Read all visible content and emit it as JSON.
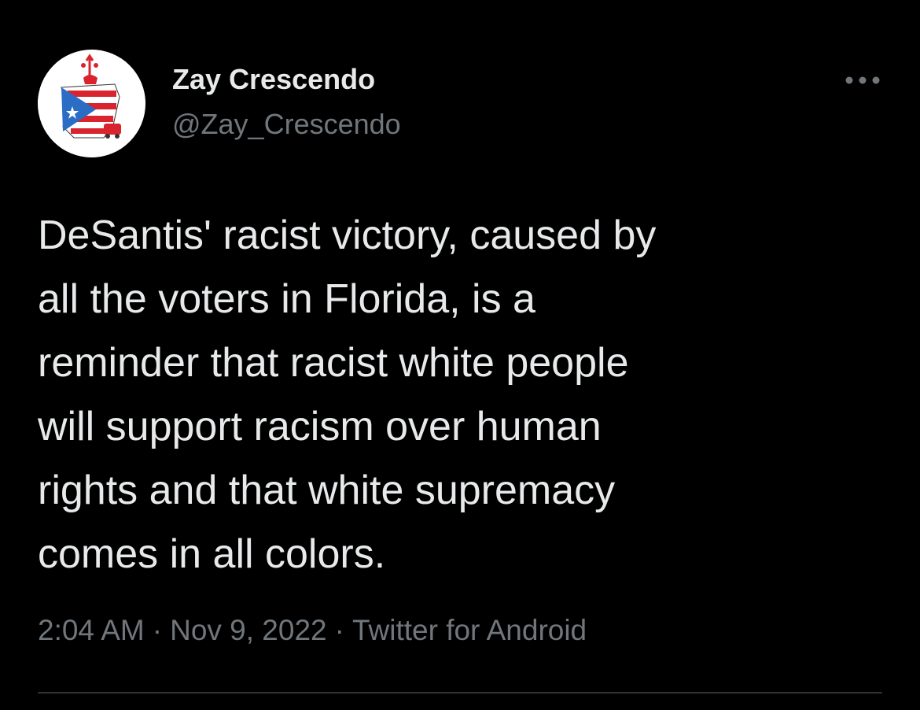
{
  "author": {
    "display_name": "Zay Crescendo",
    "handle": "@Zay_Crescendo",
    "avatar_icon": "puerto-rico-flag-avatar-icon"
  },
  "actions": {
    "more_icon": "more-horizontal-icon"
  },
  "tweet": {
    "text_lines": [
      "DeSantis' racist victory, caused by",
      "all the voters in Florida, is a",
      "reminder that racist white people",
      "will support racism over human",
      "rights and that white supremacy",
      "comes in all colors."
    ],
    "time": "2:04 AM",
    "date": "Nov 9, 2022",
    "source": "Twitter for Android",
    "separator": "·"
  },
  "colors": {
    "background": "#000000",
    "primary_text": "#e7e9ea",
    "secondary_text": "#71767b",
    "divider": "#2f3336"
  }
}
